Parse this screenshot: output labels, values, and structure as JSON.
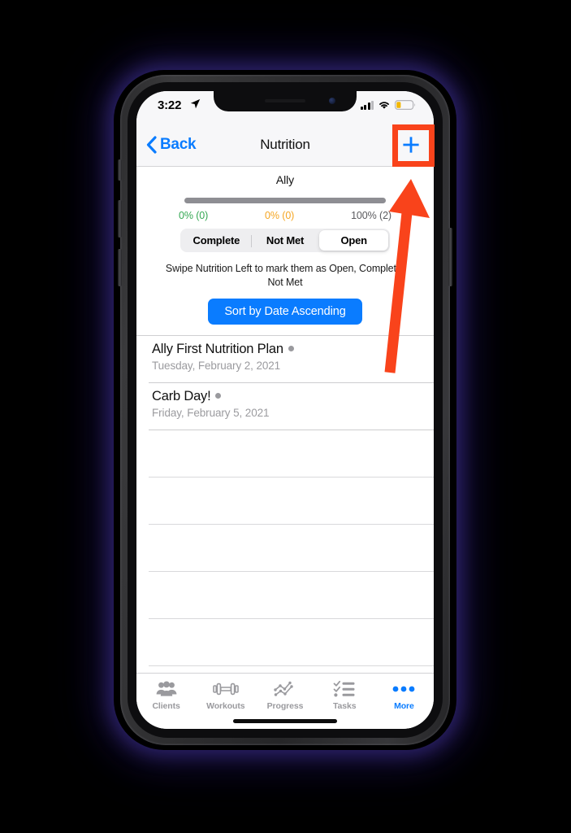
{
  "status_bar": {
    "time": "3:22",
    "location_icon": "location-arrow-icon",
    "signal_icon": "cellular-signal-icon",
    "wifi_icon": "wifi-icon",
    "battery_icon": "battery-low-icon",
    "battery_color": "#f2b705"
  },
  "nav_bar": {
    "back_label": "Back",
    "back_icon": "chevron-left-icon",
    "title": "Nutrition",
    "add_icon": "plus-icon",
    "accent_color": "#0a7cff"
  },
  "header": {
    "client_name": "Ally",
    "progress": {
      "segments": [
        {
          "label": "complete",
          "percent": 0,
          "color": "#34a853"
        },
        {
          "label": "not_met",
          "percent": 0,
          "color": "#f5a623"
        },
        {
          "label": "open",
          "percent": 100,
          "color": "#8e8e93"
        }
      ]
    },
    "stats": [
      {
        "key": "complete",
        "text": "0% (0)",
        "color": "#34a853"
      },
      {
        "key": "not_met",
        "text": "0% (0)",
        "color": "#f5a623"
      },
      {
        "key": "open",
        "text": "100% (2)",
        "color": "#5a5a5e"
      }
    ],
    "segmented_control": {
      "options": [
        "Complete",
        "Not Met",
        "Open"
      ],
      "selected": "Open"
    },
    "swipe_hint": "Swipe Nutrition Left to mark them as Open, Complete, Not Met",
    "sort_button_label": "Sort by Date Ascending"
  },
  "list": {
    "rows": [
      {
        "title": "Ally First Nutrition Plan",
        "date": "Tuesday, February 2, 2021",
        "status_dot": "#9a9a9e"
      },
      {
        "title": "Carb Day!",
        "date": "Friday, February 5, 2021",
        "status_dot": "#9a9a9e"
      }
    ],
    "empty_row_count": 5
  },
  "tab_bar": {
    "items": [
      {
        "label": "Clients",
        "icon": "people-group-icon",
        "active": false
      },
      {
        "label": "Workouts",
        "icon": "dumbbell-icon",
        "active": false
      },
      {
        "label": "Progress",
        "icon": "line-chart-icon",
        "active": false
      },
      {
        "label": "Tasks",
        "icon": "checklist-icon",
        "active": false
      },
      {
        "label": "More",
        "icon": "ellipsis-icon",
        "active": true
      }
    ],
    "inactive_color": "#9a9a9e",
    "active_color": "#0a7cff"
  },
  "annotations": {
    "highlight_color": "#f9431b",
    "highlight_target": "plus-icon",
    "arrow_points_to": "plus-icon"
  }
}
